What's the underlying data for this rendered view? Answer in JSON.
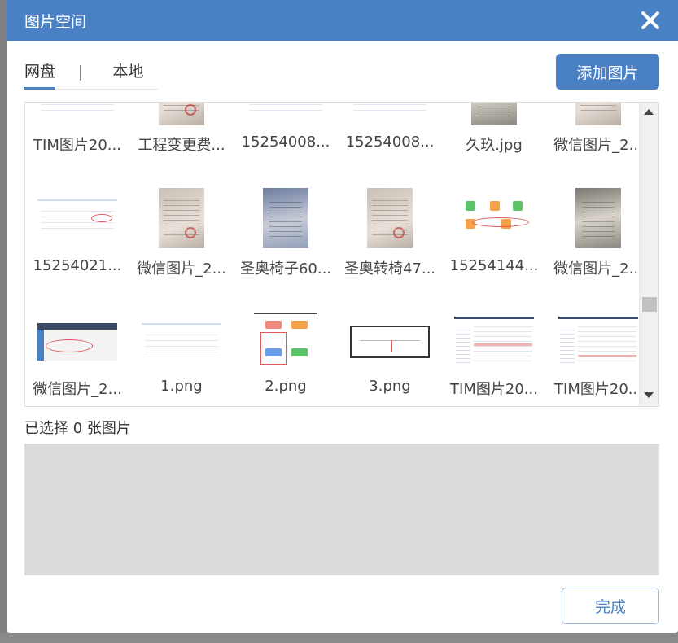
{
  "dialog": {
    "title": "图片空间",
    "close_icon": "close-icon"
  },
  "tabs": [
    {
      "label": "网盘",
      "active": true
    },
    {
      "label": "本地",
      "active": false
    }
  ],
  "tab_separator": "|",
  "add_button": {
    "label": "添加图片"
  },
  "images": {
    "row1": [
      {
        "name": "TIM图片20..."
      },
      {
        "name": "工程变更费..."
      },
      {
        "name": "15254008..."
      },
      {
        "name": "15254008..."
      },
      {
        "name": "久玖.jpg"
      },
      {
        "name": "微信图片_2..."
      }
    ],
    "row2": [
      {
        "name": "15254021..."
      },
      {
        "name": "微信图片_2..."
      },
      {
        "name": "圣奥椅子60..."
      },
      {
        "name": "圣奥转椅47..."
      },
      {
        "name": "15254144..."
      },
      {
        "name": "微信图片_2..."
      }
    ],
    "row3": [
      {
        "name": "微信图片_2..."
      },
      {
        "name": "1.png"
      },
      {
        "name": "2.png"
      },
      {
        "name": "3.png"
      },
      {
        "name": "TIM图片20..."
      },
      {
        "name": "TIM图片20..."
      }
    ]
  },
  "selection": {
    "label": "已选择 0 张图片",
    "count": 0
  },
  "done_button": {
    "label": "完成"
  },
  "colors": {
    "accent": "#4a81c4",
    "selected_area_bg": "#dcdcdc"
  }
}
